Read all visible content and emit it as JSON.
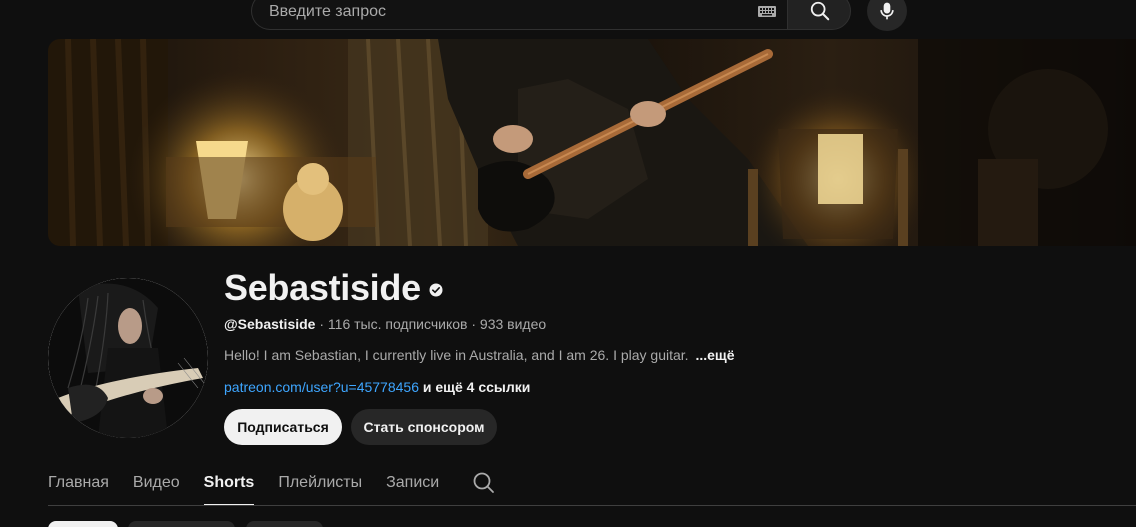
{
  "search": {
    "placeholder": "Введите запрос",
    "keyboard_icon": "keyboard-icon",
    "search_icon": "search-icon",
    "mic_icon": "microphone-icon"
  },
  "channel": {
    "name": "Sebastiside",
    "verified_icon": "verified-check-icon",
    "handle": "@Sebastiside",
    "stats": " · 116 тыс. подписчиков · 933 видео",
    "description": "Hello! I am Sebastian, I currently live in Australia, and I am 26. I play guitar.",
    "more": "...ещё",
    "link": "patreon.com/user?u=45778456",
    "more_links": " и ещё 4 ссылки",
    "subscribe_label": "Подписаться",
    "sponsor_label": "Стать спонсором"
  },
  "tabs": [
    {
      "label": "Главная",
      "active": false
    },
    {
      "label": "Видео",
      "active": false
    },
    {
      "label": "Shorts",
      "active": true
    },
    {
      "label": "Плейлисты",
      "active": false
    },
    {
      "label": "Записи",
      "active": false
    }
  ],
  "tabs_search_icon": "search-icon",
  "colors": {
    "background": "#0f0f0f",
    "link": "#3ea6ff",
    "text_primary": "#f1f1f1",
    "text_secondary": "#aaaaaa"
  }
}
